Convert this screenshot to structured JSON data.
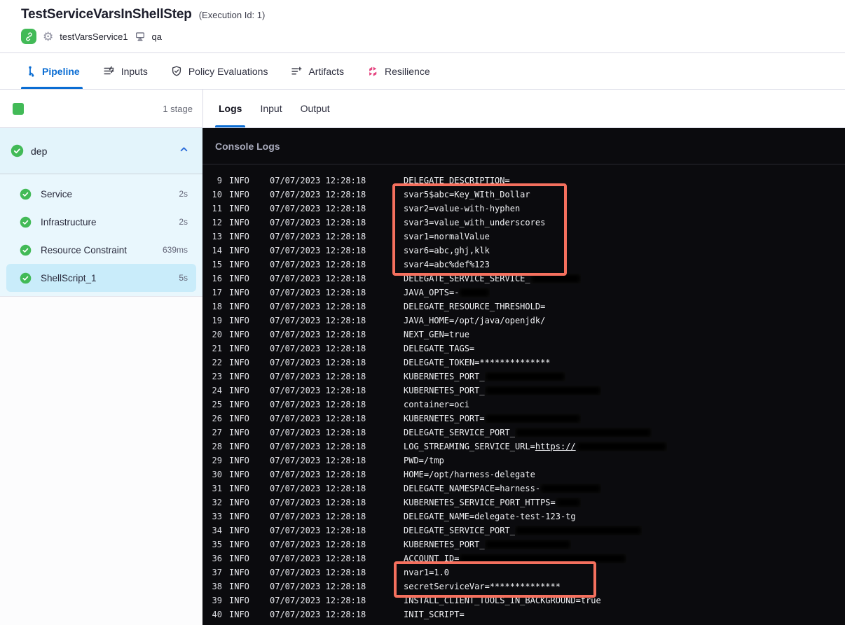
{
  "header": {
    "title": "TestServiceVarsInShellStep",
    "execution_id": "(Execution Id: 1)",
    "service_name": "testVarsService1",
    "environment_name": "qa"
  },
  "module_tabs": [
    {
      "label": "Pipeline",
      "icon": "pipeline-icon",
      "active": true
    },
    {
      "label": "Inputs",
      "icon": "inputs-icon",
      "active": false
    },
    {
      "label": "Policy Evaluations",
      "icon": "policy-evaluations-icon",
      "active": false
    },
    {
      "label": "Artifacts",
      "icon": "artifacts-icon",
      "active": false
    },
    {
      "label": "Resilience",
      "icon": "resilience-icon",
      "active": false
    }
  ],
  "sidebar": {
    "stage_count_label": "1 stage",
    "group": {
      "label": "dep",
      "status": "success",
      "expanded": true
    },
    "steps": [
      {
        "label": "Service",
        "duration": "2s",
        "status": "success",
        "selected": false
      },
      {
        "label": "Infrastructure",
        "duration": "2s",
        "status": "success",
        "selected": false
      },
      {
        "label": "Resource Constraint",
        "duration": "639ms",
        "status": "success",
        "selected": false
      },
      {
        "label": "ShellScript_1",
        "duration": "5s",
        "status": "success",
        "selected": true
      }
    ]
  },
  "log_panel": {
    "tabs": [
      {
        "label": "Logs",
        "active": true
      },
      {
        "label": "Input",
        "active": false
      },
      {
        "label": "Output",
        "active": false
      }
    ]
  },
  "console": {
    "title": "Console Logs",
    "lines": [
      {
        "n": 9,
        "level": "INFO",
        "ts": "07/07/2023 12:28:18",
        "parts": [
          {
            "text": "DELEGATE_DESCRIPTION="
          }
        ]
      },
      {
        "n": 10,
        "level": "INFO",
        "ts": "07/07/2023 12:28:18",
        "parts": [
          {
            "text": "svar5$abc=Key_WIth_Dollar"
          }
        ]
      },
      {
        "n": 11,
        "level": "INFO",
        "ts": "07/07/2023 12:28:18",
        "parts": [
          {
            "text": "svar2=value-with-hyphen"
          }
        ]
      },
      {
        "n": 12,
        "level": "INFO",
        "ts": "07/07/2023 12:28:18",
        "parts": [
          {
            "text": "svar3=value_with_underscores"
          }
        ]
      },
      {
        "n": 13,
        "level": "INFO",
        "ts": "07/07/2023 12:28:18",
        "parts": [
          {
            "text": "svar1=normalValue"
          }
        ]
      },
      {
        "n": 14,
        "level": "INFO",
        "ts": "07/07/2023 12:28:18",
        "parts": [
          {
            "text": "svar6=abc,ghj,klk"
          }
        ]
      },
      {
        "n": 15,
        "level": "INFO",
        "ts": "07/07/2023 12:28:18",
        "parts": [
          {
            "text": "svar4=abc%def%123"
          }
        ]
      },
      {
        "n": 16,
        "level": "INFO",
        "ts": "07/07/2023 12:28:18",
        "parts": [
          {
            "text": "DELEGATE_SERVICE_SERVICE_"
          },
          {
            "redact_ch": 10
          }
        ]
      },
      {
        "n": 17,
        "level": "INFO",
        "ts": "07/07/2023 12:28:18",
        "parts": [
          {
            "text": "JAVA_OPTS=-"
          },
          {
            "redact_ch": 6
          }
        ]
      },
      {
        "n": 18,
        "level": "INFO",
        "ts": "07/07/2023 12:28:18",
        "parts": [
          {
            "text": "DELEGATE_RESOURCE_THRESHOLD="
          }
        ]
      },
      {
        "n": 19,
        "level": "INFO",
        "ts": "07/07/2023 12:28:18",
        "parts": [
          {
            "text": "JAVA_HOME=/opt/java/openjdk/"
          }
        ]
      },
      {
        "n": 20,
        "level": "INFO",
        "ts": "07/07/2023 12:28:18",
        "parts": [
          {
            "text": "NEXT_GEN=true"
          }
        ]
      },
      {
        "n": 21,
        "level": "INFO",
        "ts": "07/07/2023 12:28:18",
        "parts": [
          {
            "text": "DELEGATE_TAGS="
          }
        ]
      },
      {
        "n": 22,
        "level": "INFO",
        "ts": "07/07/2023 12:28:18",
        "parts": [
          {
            "text": "DELEGATE_TOKEN=**************"
          }
        ]
      },
      {
        "n": 23,
        "level": "INFO",
        "ts": "07/07/2023 12:28:18",
        "parts": [
          {
            "text": "KUBERNETES_PORT_"
          },
          {
            "redact_ch": 16
          }
        ]
      },
      {
        "n": 24,
        "level": "INFO",
        "ts": "07/07/2023 12:28:18",
        "parts": [
          {
            "text": "KUBERNETES_PORT_"
          },
          {
            "redact_ch": 23
          }
        ]
      },
      {
        "n": 25,
        "level": "INFO",
        "ts": "07/07/2023 12:28:18",
        "parts": [
          {
            "text": "container=oci"
          }
        ]
      },
      {
        "n": 26,
        "level": "INFO",
        "ts": "07/07/2023 12:28:18",
        "parts": [
          {
            "text": "KUBERNETES_PORT="
          },
          {
            "redact_ch": 19
          }
        ]
      },
      {
        "n": 27,
        "level": "INFO",
        "ts": "07/07/2023 12:28:18",
        "parts": [
          {
            "text": "DELEGATE_SERVICE_PORT_"
          },
          {
            "redact_ch": 27
          }
        ]
      },
      {
        "n": 28,
        "level": "INFO",
        "ts": "07/07/2023 12:28:18",
        "parts": [
          {
            "text": "LOG_STREAMING_SERVICE_URL="
          },
          {
            "link": "https://"
          },
          {
            "redact_ch": 18
          }
        ]
      },
      {
        "n": 29,
        "level": "INFO",
        "ts": "07/07/2023 12:28:18",
        "parts": [
          {
            "text": "PWD=/tmp"
          }
        ]
      },
      {
        "n": 30,
        "level": "INFO",
        "ts": "07/07/2023 12:28:18",
        "parts": [
          {
            "text": "HOME=/opt/harness-delegate"
          }
        ]
      },
      {
        "n": 31,
        "level": "INFO",
        "ts": "07/07/2023 12:28:18",
        "parts": [
          {
            "text": "DELEGATE_NAMESPACE=harness-"
          },
          {
            "redact_ch": 12
          }
        ]
      },
      {
        "n": 32,
        "level": "INFO",
        "ts": "07/07/2023 12:28:18",
        "parts": [
          {
            "text": "KUBERNETES_SERVICE_PORT_HTTPS="
          },
          {
            "redact_ch": 5
          }
        ]
      },
      {
        "n": 33,
        "level": "INFO",
        "ts": "07/07/2023 12:28:18",
        "parts": [
          {
            "text": "DELEGATE_NAME=delegate-test-123-tg"
          }
        ]
      },
      {
        "n": 34,
        "level": "INFO",
        "ts": "07/07/2023 12:28:18",
        "parts": [
          {
            "text": "DELEGATE_SERVICE_PORT_"
          },
          {
            "redact_ch": 25
          }
        ]
      },
      {
        "n": 35,
        "level": "INFO",
        "ts": "07/07/2023 12:28:18",
        "parts": [
          {
            "text": "KUBERNETES_PORT_"
          },
          {
            "redact_ch": 17
          }
        ]
      },
      {
        "n": 36,
        "level": "INFO",
        "ts": "07/07/2023 12:28:18",
        "parts": [
          {
            "text": "ACCOUNT_ID="
          },
          {
            "redact_ch": 33
          }
        ]
      },
      {
        "n": 37,
        "level": "INFO",
        "ts": "07/07/2023 12:28:18",
        "parts": [
          {
            "text": "nvar1=1.0"
          }
        ]
      },
      {
        "n": 38,
        "level": "INFO",
        "ts": "07/07/2023 12:28:18",
        "parts": [
          {
            "text": "secretServiceVar=**************"
          }
        ]
      },
      {
        "n": 39,
        "level": "INFO",
        "ts": "07/07/2023 12:28:18",
        "parts": [
          {
            "text": "INSTALL_CLIENT_TOOLS_IN_BACKGROUND=true"
          }
        ]
      },
      {
        "n": 40,
        "level": "INFO",
        "ts": "07/07/2023 12:28:18",
        "parts": [
          {
            "text": "INIT_SCRIPT="
          }
        ]
      }
    ],
    "highlights": [
      {
        "from": 10,
        "to": 15
      },
      {
        "from": 37,
        "to": 38
      }
    ]
  },
  "colors": {
    "accent_blue": "#0b6dd3",
    "success_green": "#42ba57",
    "resilience_pink": "#e5437f",
    "highlight_border": "#f5705e",
    "console_bg": "#0b0b0e",
    "selected_step_bg": "#c9ecfa"
  }
}
